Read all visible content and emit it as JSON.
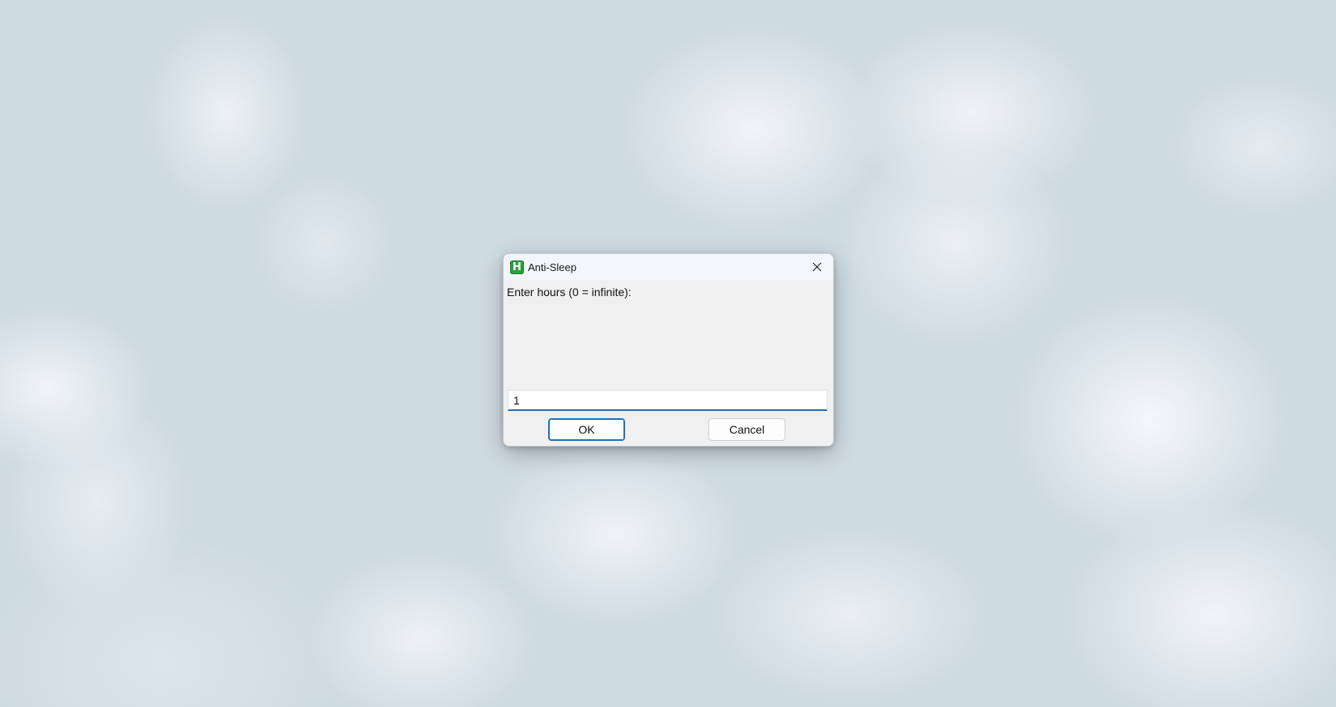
{
  "window": {
    "title": "Anti-Sleep",
    "icon": "app-h-icon",
    "icon_letter": "H",
    "icon_color": "#2e9d3f"
  },
  "prompt": {
    "label": "Enter hours (0 = infinite):"
  },
  "input": {
    "value": "1"
  },
  "buttons": {
    "ok_label": "OK",
    "cancel_label": "Cancel"
  },
  "colors": {
    "accent": "#1f6fb5",
    "dialog_bg": "#f0f0f0",
    "desktop_bg": "#cfdbe3"
  }
}
